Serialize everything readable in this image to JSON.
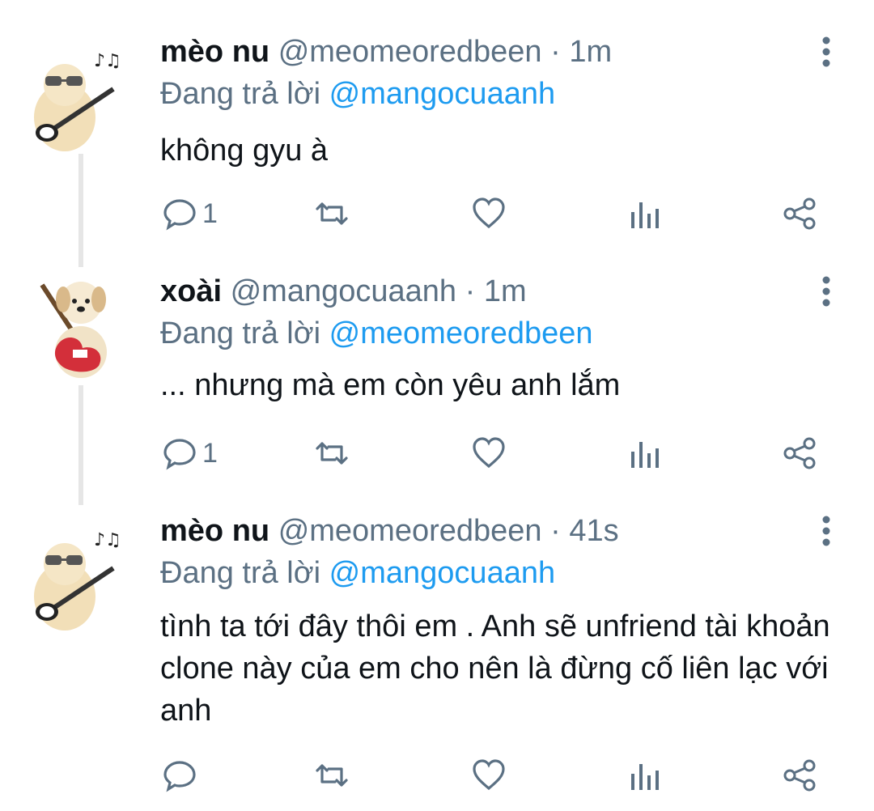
{
  "tweets": [
    {
      "name": "mèo nu",
      "handle": "@meomeoredbeen",
      "time": "1m",
      "reply_prefix": "Đang trả lời",
      "reply_to": "@mangocuaanh",
      "text": "không gyu à",
      "reply_count": "1",
      "avatar_icon": "cat-guitar-sunglasses-avatar"
    },
    {
      "name": "xoài",
      "handle": "@mangocuaanh",
      "time": "1m",
      "reply_prefix": "Đang trả lời",
      "reply_to": "@meomeoredbeen",
      "text": "... nhưng mà em còn yêu anh lắm",
      "reply_count": "1",
      "avatar_icon": "puppy-guitar-avatar"
    },
    {
      "name": "mèo nu",
      "handle": "@meomeoredbeen",
      "time": "41s",
      "reply_prefix": "Đang trả lời",
      "reply_to": "@mangocuaanh",
      "text": "tình ta tới đây thôi em . Anh sẽ unfriend tài khoản clone này của em cho nên là đừng cố liên lạc với anh",
      "reply_count": "",
      "avatar_icon": "cat-guitar-sunglasses-avatar"
    }
  ],
  "separator": "·",
  "colors": {
    "text": "#0f1419",
    "secondary": "#5b7083",
    "mention": "#1d9bf0",
    "thread_line": "#e6e6e6"
  }
}
